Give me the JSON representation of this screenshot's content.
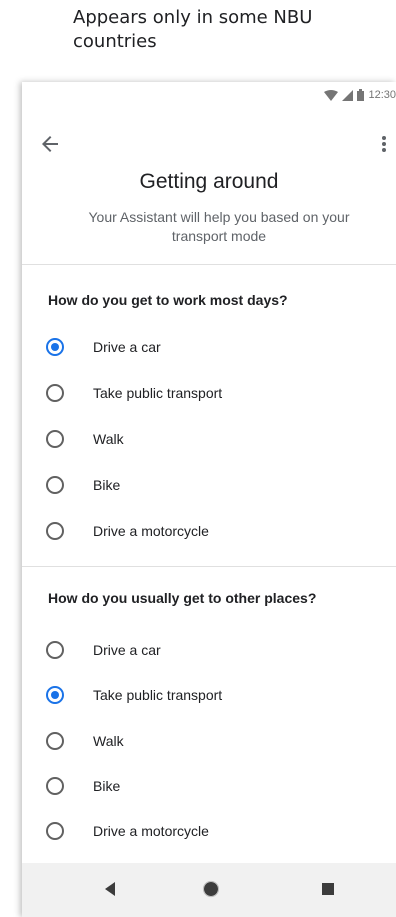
{
  "caption": "Appears only in some NBU countries",
  "status_bar": {
    "time": "12:30"
  },
  "screen": {
    "title": "Getting around",
    "subtitle": "Your Assistant will help you based on your transport mode"
  },
  "questions": [
    {
      "label": "How do you get to work most days?",
      "options": [
        {
          "label": "Drive a car",
          "selected": true
        },
        {
          "label": "Take public transport",
          "selected": false
        },
        {
          "label": "Walk",
          "selected": false
        },
        {
          "label": "Bike",
          "selected": false
        },
        {
          "label": "Drive a motorcycle",
          "selected": false
        }
      ]
    },
    {
      "label": "How do you usually get to other places?",
      "options": [
        {
          "label": "Drive a car",
          "selected": false
        },
        {
          "label": "Take public transport",
          "selected": true
        },
        {
          "label": "Walk",
          "selected": false
        },
        {
          "label": "Bike",
          "selected": false
        },
        {
          "label": "Drive a motorcycle",
          "selected": false
        }
      ]
    }
  ],
  "colors": {
    "accent": "#1a73e8",
    "nav_bar": "#f1f1f1"
  },
  "icons": [
    "wifi-icon",
    "signal-icon",
    "battery-icon",
    "back-arrow-icon",
    "more-vert-icon",
    "nav-back-icon",
    "nav-home-icon",
    "nav-recents-icon"
  ]
}
